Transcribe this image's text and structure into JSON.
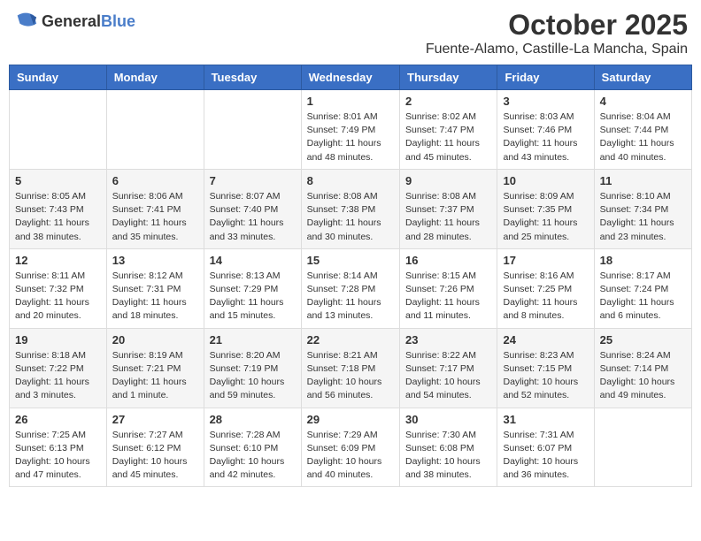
{
  "header": {
    "logo_general": "General",
    "logo_blue": "Blue",
    "month_title": "October 2025",
    "location": "Fuente-Alamo, Castille-La Mancha, Spain"
  },
  "days_of_week": [
    "Sunday",
    "Monday",
    "Tuesday",
    "Wednesday",
    "Thursday",
    "Friday",
    "Saturday"
  ],
  "weeks": [
    [
      {
        "day": "",
        "info": ""
      },
      {
        "day": "",
        "info": ""
      },
      {
        "day": "",
        "info": ""
      },
      {
        "day": "1",
        "info": "Sunrise: 8:01 AM\nSunset: 7:49 PM\nDaylight: 11 hours\nand 48 minutes."
      },
      {
        "day": "2",
        "info": "Sunrise: 8:02 AM\nSunset: 7:47 PM\nDaylight: 11 hours\nand 45 minutes."
      },
      {
        "day": "3",
        "info": "Sunrise: 8:03 AM\nSunset: 7:46 PM\nDaylight: 11 hours\nand 43 minutes."
      },
      {
        "day": "4",
        "info": "Sunrise: 8:04 AM\nSunset: 7:44 PM\nDaylight: 11 hours\nand 40 minutes."
      }
    ],
    [
      {
        "day": "5",
        "info": "Sunrise: 8:05 AM\nSunset: 7:43 PM\nDaylight: 11 hours\nand 38 minutes."
      },
      {
        "day": "6",
        "info": "Sunrise: 8:06 AM\nSunset: 7:41 PM\nDaylight: 11 hours\nand 35 minutes."
      },
      {
        "day": "7",
        "info": "Sunrise: 8:07 AM\nSunset: 7:40 PM\nDaylight: 11 hours\nand 33 minutes."
      },
      {
        "day": "8",
        "info": "Sunrise: 8:08 AM\nSunset: 7:38 PM\nDaylight: 11 hours\nand 30 minutes."
      },
      {
        "day": "9",
        "info": "Sunrise: 8:08 AM\nSunset: 7:37 PM\nDaylight: 11 hours\nand 28 minutes."
      },
      {
        "day": "10",
        "info": "Sunrise: 8:09 AM\nSunset: 7:35 PM\nDaylight: 11 hours\nand 25 minutes."
      },
      {
        "day": "11",
        "info": "Sunrise: 8:10 AM\nSunset: 7:34 PM\nDaylight: 11 hours\nand 23 minutes."
      }
    ],
    [
      {
        "day": "12",
        "info": "Sunrise: 8:11 AM\nSunset: 7:32 PM\nDaylight: 11 hours\nand 20 minutes."
      },
      {
        "day": "13",
        "info": "Sunrise: 8:12 AM\nSunset: 7:31 PM\nDaylight: 11 hours\nand 18 minutes."
      },
      {
        "day": "14",
        "info": "Sunrise: 8:13 AM\nSunset: 7:29 PM\nDaylight: 11 hours\nand 15 minutes."
      },
      {
        "day": "15",
        "info": "Sunrise: 8:14 AM\nSunset: 7:28 PM\nDaylight: 11 hours\nand 13 minutes."
      },
      {
        "day": "16",
        "info": "Sunrise: 8:15 AM\nSunset: 7:26 PM\nDaylight: 11 hours\nand 11 minutes."
      },
      {
        "day": "17",
        "info": "Sunrise: 8:16 AM\nSunset: 7:25 PM\nDaylight: 11 hours\nand 8 minutes."
      },
      {
        "day": "18",
        "info": "Sunrise: 8:17 AM\nSunset: 7:24 PM\nDaylight: 11 hours\nand 6 minutes."
      }
    ],
    [
      {
        "day": "19",
        "info": "Sunrise: 8:18 AM\nSunset: 7:22 PM\nDaylight: 11 hours\nand 3 minutes."
      },
      {
        "day": "20",
        "info": "Sunrise: 8:19 AM\nSunset: 7:21 PM\nDaylight: 11 hours\nand 1 minute."
      },
      {
        "day": "21",
        "info": "Sunrise: 8:20 AM\nSunset: 7:19 PM\nDaylight: 10 hours\nand 59 minutes."
      },
      {
        "day": "22",
        "info": "Sunrise: 8:21 AM\nSunset: 7:18 PM\nDaylight: 10 hours\nand 56 minutes."
      },
      {
        "day": "23",
        "info": "Sunrise: 8:22 AM\nSunset: 7:17 PM\nDaylight: 10 hours\nand 54 minutes."
      },
      {
        "day": "24",
        "info": "Sunrise: 8:23 AM\nSunset: 7:15 PM\nDaylight: 10 hours\nand 52 minutes."
      },
      {
        "day": "25",
        "info": "Sunrise: 8:24 AM\nSunset: 7:14 PM\nDaylight: 10 hours\nand 49 minutes."
      }
    ],
    [
      {
        "day": "26",
        "info": "Sunrise: 7:25 AM\nSunset: 6:13 PM\nDaylight: 10 hours\nand 47 minutes."
      },
      {
        "day": "27",
        "info": "Sunrise: 7:27 AM\nSunset: 6:12 PM\nDaylight: 10 hours\nand 45 minutes."
      },
      {
        "day": "28",
        "info": "Sunrise: 7:28 AM\nSunset: 6:10 PM\nDaylight: 10 hours\nand 42 minutes."
      },
      {
        "day": "29",
        "info": "Sunrise: 7:29 AM\nSunset: 6:09 PM\nDaylight: 10 hours\nand 40 minutes."
      },
      {
        "day": "30",
        "info": "Sunrise: 7:30 AM\nSunset: 6:08 PM\nDaylight: 10 hours\nand 38 minutes."
      },
      {
        "day": "31",
        "info": "Sunrise: 7:31 AM\nSunset: 6:07 PM\nDaylight: 10 hours\nand 36 minutes."
      },
      {
        "day": "",
        "info": ""
      }
    ]
  ]
}
